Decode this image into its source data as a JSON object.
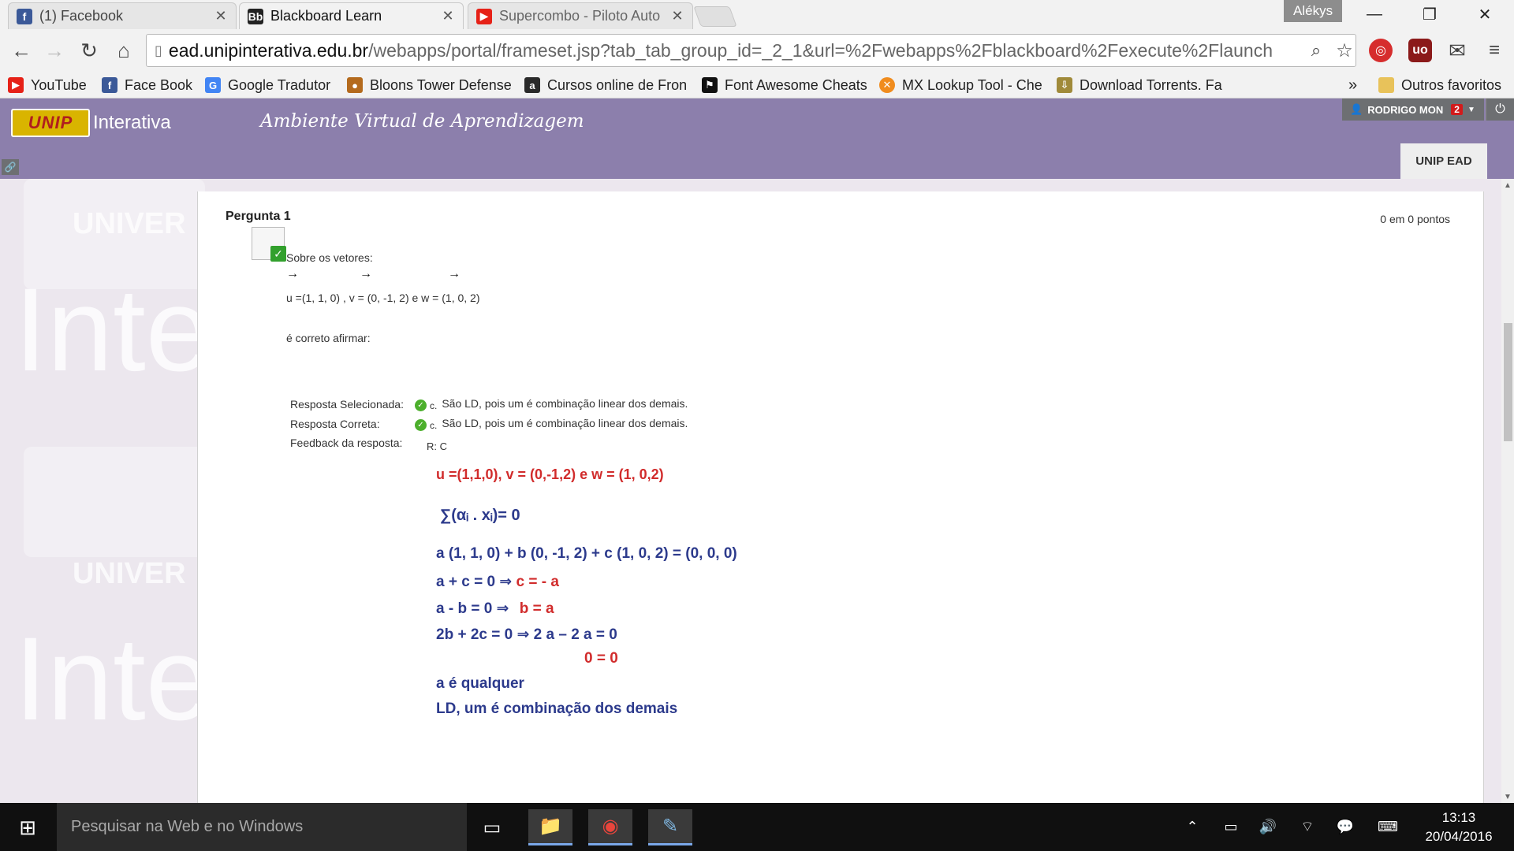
{
  "browser": {
    "tabs": [
      {
        "title": "(1) Facebook",
        "icon": "facebook-icon"
      },
      {
        "title": "Blackboard Learn",
        "icon": "blackboard-icon"
      },
      {
        "title": "Supercombo - Piloto Auto",
        "icon": "youtube-icon"
      }
    ],
    "profile_name": "Alékys",
    "url_domain": "ead.unipinterativa.edu.br",
    "url_rest": "/webapps/portal/frameset.jsp?tab_tab_group_id=_2_1&url=%2Fwebapps%2Fblackboard%2Fexecute%2Flaunch",
    "bookmarks": [
      {
        "label": "YouTube",
        "icon": "youtube-icon"
      },
      {
        "label": "Face Book",
        "icon": "facebook-icon"
      },
      {
        "label": "Google Tradutor",
        "icon": "google-translate-icon"
      },
      {
        "label": "Bloons Tower Defense",
        "icon": "bloons-icon"
      },
      {
        "label": "Cursos online de Fron",
        "icon": "alura-icon"
      },
      {
        "label": "Font Awesome Cheats",
        "icon": "flag-icon"
      },
      {
        "label": "MX Lookup Tool - Che",
        "icon": "mxtoolbox-icon"
      },
      {
        "label": "Download Torrents. Fa",
        "icon": "torrent-icon"
      }
    ],
    "overflow_label": "»",
    "other_bookmarks": "Outros favoritos"
  },
  "header": {
    "logo_text": "UNIP",
    "brand": "Interativa",
    "title": "Ambiente Virtual de Aprendizagem",
    "user": "RODRIGO MON",
    "notifications": "2",
    "tab": "UNIP EAD"
  },
  "watermark": {
    "univer": "UNIVER",
    "inte": "Inte"
  },
  "question": {
    "title": "Pergunta 1",
    "points": "0 em 0 pontos",
    "intro": "Sobre os vetores:",
    "vectors": "u  =(1, 1, 0) , v  = (0, -1, 2) e w  = (1, 0, 2)",
    "prompt": "é correto afirmar:",
    "selected_label": "Resposta Selecionada:",
    "correct_label": "Resposta Correta:",
    "feedback_label": "Feedback da resposta:",
    "answer_letter": "c.",
    "answer_text": "São LD, pois um é combinação linear dos demais.",
    "feedback_r": "R: C"
  },
  "feedback_image": {
    "line1": "u =(1,1,0), v = (0,-1,2) e  w = (1, 0,2)",
    "line2": "∑(αᵢ . xᵢ)= 0",
    "line3": "a (1, 1, 0) + b (0, -1, 2) + c (1, 0, 2) = (0, 0, 0)",
    "line4a": "a + c = 0 ⇒",
    "line4b": "c = - a",
    "line5a": "a - b = 0 ⇒",
    "line5b": "b = a",
    "line6": "2b + 2c = 0 ⇒ 2 a – 2 a = 0",
    "line7": "0 = 0",
    "line8": "a é qualquer",
    "line9": "LD, um é combinação dos demais"
  },
  "taskbar": {
    "search_placeholder": "Pesquisar na Web e no Windows",
    "time": "13:13",
    "date": "20/04/2016"
  }
}
